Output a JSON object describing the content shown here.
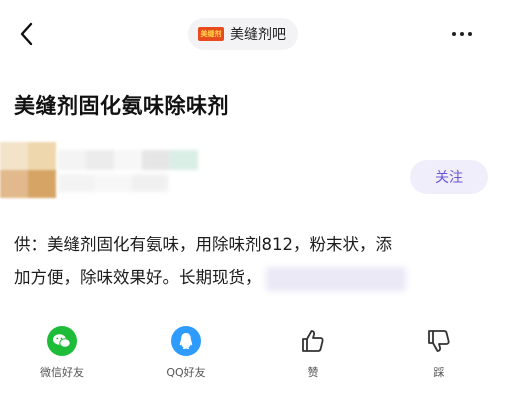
{
  "header": {
    "back_icon": "chevron-left-icon",
    "forum_logo_text": "美缝剂",
    "forum_name": "美缝剂吧",
    "more_icon": "more-horizontal-icon"
  },
  "post": {
    "title": "美缝剂固化氨味除味剂",
    "follow_label": "关注",
    "content_lines": [
      "供：美缝剂固化有氨味，用除味剂812，粉末状，添",
      "加方便，除味效果好。长期现货，"
    ]
  },
  "share_bar": {
    "wechat_label": "微信好友",
    "qq_label": "QQ好友",
    "like_label": "赞",
    "dislike_label": "踩"
  },
  "colors": {
    "wechat_green": "#1dbd3a",
    "qq_blue": "#2e9bff",
    "follow_bg": "#f1eefc",
    "follow_text": "#6a56d8"
  }
}
